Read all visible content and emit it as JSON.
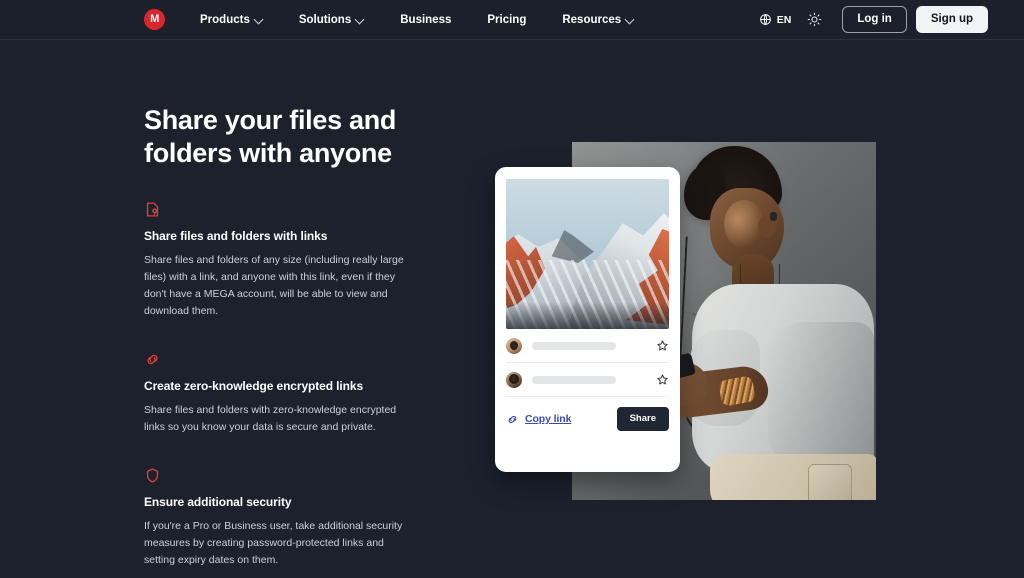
{
  "theme": {
    "page_bg": "#1c212c",
    "nav_bg": "#1b202a",
    "accent_red": "#d9272e",
    "link_blue": "#3c4ba6",
    "share_btn_bg": "#1f2634",
    "body_text": "#ccd1d9"
  },
  "nav": {
    "logo_letter": "M",
    "logo_name": "mega-logo",
    "links": [
      {
        "label": "Products",
        "has_dropdown": true
      },
      {
        "label": "Solutions",
        "has_dropdown": true
      },
      {
        "label": "Business",
        "has_dropdown": false
      },
      {
        "label": "Pricing",
        "has_dropdown": false
      },
      {
        "label": "Resources",
        "has_dropdown": true
      }
    ],
    "language": "EN",
    "language_icon": "globe-icon",
    "theme_toggle_icon": "sun-icon",
    "login_label": "Log in",
    "signup_label": "Sign up"
  },
  "hero": {
    "title_line_1": "Share your files and",
    "title_line_2": "folders with anyone",
    "features": [
      {
        "icon": "file-link-icon",
        "title": "Share files and folders with links",
        "body": "Share files and folders of any size (including really large files) with a link, and anyone with this link, even if they don't have a MEGA account, will be able to view and download them."
      },
      {
        "icon": "chain-link-icon",
        "title": "Create zero-knowledge encrypted links",
        "body": "Share files and folders with zero-knowledge encrypted links so you know your data is secure and private."
      },
      {
        "icon": "shield-icon",
        "title": "Ensure additional security",
        "body": "If you're a Pro or Business user, take additional security measures by creating password-protected links and setting expiry dates on them."
      }
    ]
  },
  "visual": {
    "photo_alt": "man-with-phone-photo",
    "card": {
      "preview_alt": "snowy-mountain-preview",
      "contacts": [
        {
          "avatar": "contact-avatar-1",
          "name_placeholder": "",
          "starred": false
        },
        {
          "avatar": "contact-avatar-2",
          "name_placeholder": "",
          "starred": false
        }
      ],
      "copy_link_label": "Copy link",
      "copy_link_icon": "chain-link-icon",
      "share_label": "Share",
      "star_icon": "star-outline-icon"
    }
  }
}
